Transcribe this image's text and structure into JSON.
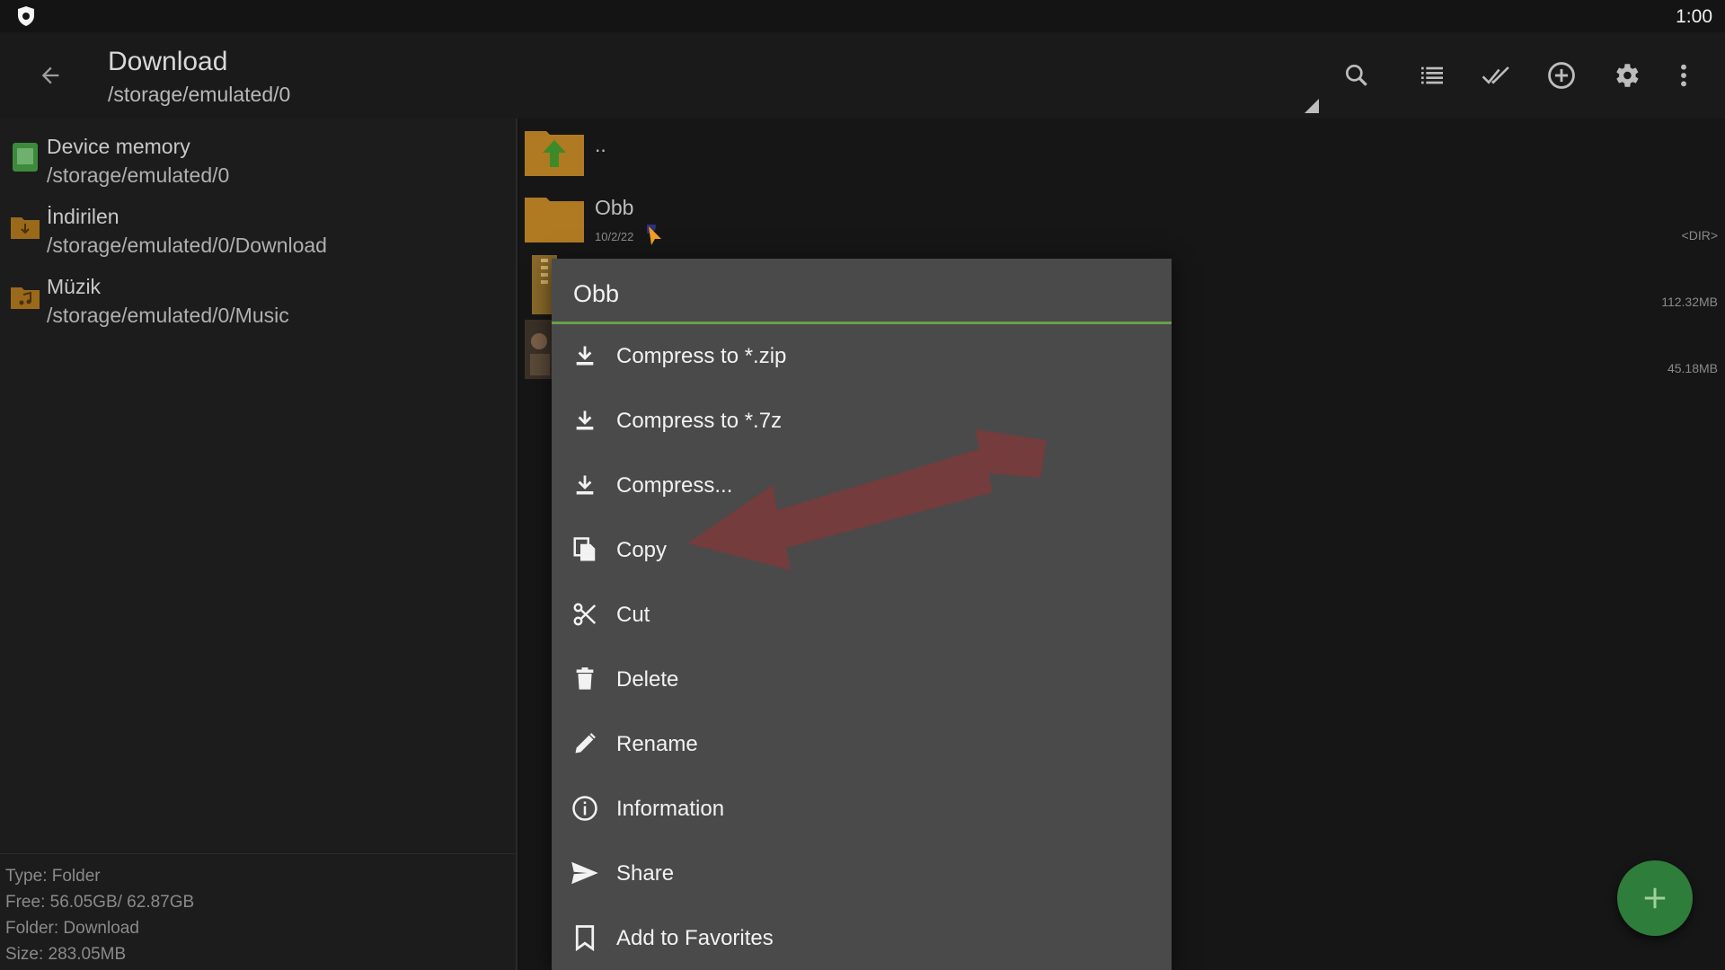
{
  "status_bar": {
    "time": "1:00"
  },
  "app_bar": {
    "title": "Download",
    "path": "/storage/emulated/0",
    "toolbar_icons": [
      "search-icon",
      "list-view-icon",
      "select-all-icon",
      "add-circle-icon",
      "settings-icon",
      "more-vert-icon"
    ]
  },
  "sidebar": {
    "items": [
      {
        "name": "Device memory",
        "path": "/storage/emulated/0",
        "icon": "sd-storage-icon",
        "color": "#3d8a3d"
      },
      {
        "name": "İndirilen",
        "path": "/storage/emulated/0/Download",
        "icon": "download-folder-icon",
        "color": "#9a6a1a"
      },
      {
        "name": "Müzik",
        "path": "/storage/emulated/0/Music",
        "icon": "music-folder-icon",
        "color": "#9a6a1a"
      }
    ],
    "info": {
      "type": "Type: Folder",
      "free": "Free: 56.05GB/ 62.87GB",
      "folder": "Folder: Download",
      "size": "Size: 283.05MB"
    }
  },
  "files": [
    {
      "name": "..",
      "date": "",
      "meta": ""
    },
    {
      "name": "Obb",
      "date": "10/2/22",
      "meta": "<DIR>"
    },
    {
      "name": "",
      "date": "",
      "meta": "112.32MB"
    },
    {
      "name": "",
      "date": "",
      "meta": "45.18MB"
    }
  ],
  "context_menu": {
    "title": "Obb",
    "items": [
      {
        "label": "Compress to *.zip",
        "icon": "download-icon"
      },
      {
        "label": "Compress to *.7z",
        "icon": "download-icon"
      },
      {
        "label": "Compress...",
        "icon": "download-icon"
      },
      {
        "label": "Copy",
        "icon": "copy-icon"
      },
      {
        "label": "Cut",
        "icon": "scissors-icon"
      },
      {
        "label": "Delete",
        "icon": "trash-icon"
      },
      {
        "label": "Rename",
        "icon": "pencil-icon"
      },
      {
        "label": "Information",
        "icon": "info-icon"
      },
      {
        "label": "Share",
        "icon": "send-icon"
      },
      {
        "label": "Add to Favorites",
        "icon": "bookmark-icon"
      }
    ]
  },
  "colors": {
    "accent": "#6aa04a",
    "fab": "#2f7d3a",
    "folder": "#b07a22",
    "annotation_arrow": "#7a3a3a"
  }
}
